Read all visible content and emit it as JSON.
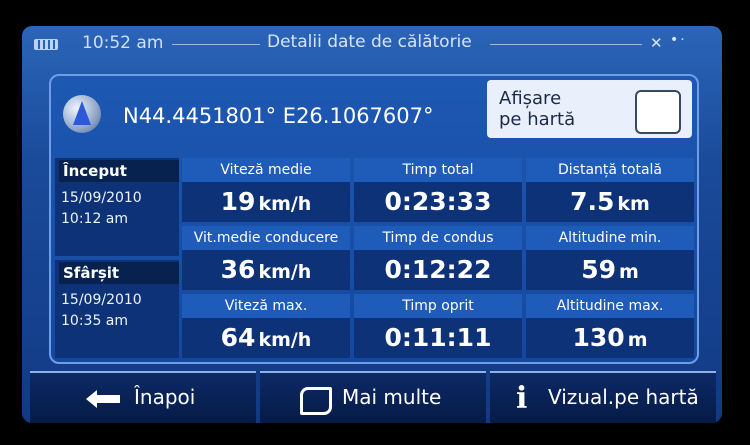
{
  "status_bar": {
    "time": "10:52 am",
    "title": "Detalii date de călătorie",
    "gps_status_icon": "satellite-icon",
    "battery_icon": "battery-icon"
  },
  "location": {
    "coordinates": "N44.4451801° E26.1067607°",
    "icon": "gps-arrow-icon"
  },
  "map_toggle": {
    "label_line1": "Afișare",
    "label_line2": "pe hartă",
    "checked": false
  },
  "trip": {
    "start_label": "Început",
    "start_date": "15/09/2010",
    "start_time": "10:12 am",
    "end_label": "Sfârșit",
    "end_date": "15/09/2010",
    "end_time": "10:35 am"
  },
  "stats": {
    "avg_speed": {
      "label": "Viteză medie",
      "value": "19",
      "unit": "km/h"
    },
    "total_time": {
      "label": "Timp total",
      "value": "0:23:33",
      "unit": ""
    },
    "total_distance": {
      "label": "Distanță totală",
      "value": "7.5",
      "unit": "km"
    },
    "avg_driving_speed": {
      "label": "Vit.medie conducere",
      "value": "36",
      "unit": "km/h"
    },
    "driving_time": {
      "label": "Timp de condus",
      "value": "0:12:22",
      "unit": ""
    },
    "min_altitude": {
      "label": "Altitudine min.",
      "value": "59",
      "unit": "m"
    },
    "max_speed": {
      "label": "Viteză max.",
      "value": "64",
      "unit": "km/h"
    },
    "stopped_time": {
      "label": "Timp oprit",
      "value": "0:11:11",
      "unit": ""
    },
    "max_altitude": {
      "label": "Altitudine max.",
      "value": "130",
      "unit": "m"
    }
  },
  "buttons": {
    "back": {
      "label": "Înapoi",
      "icon": "arrow-left-icon"
    },
    "more": {
      "label": "Mai multe",
      "icon": "more-icon"
    },
    "view_on_map": {
      "label": "Vizual.pe hartă",
      "icon": "info-icon"
    }
  },
  "colors": {
    "screen_bg": "#1a4a9a",
    "cell_bg": "#0e3278",
    "label_bg": "#1f5bb8",
    "accent_border": "#6e9ee6"
  }
}
